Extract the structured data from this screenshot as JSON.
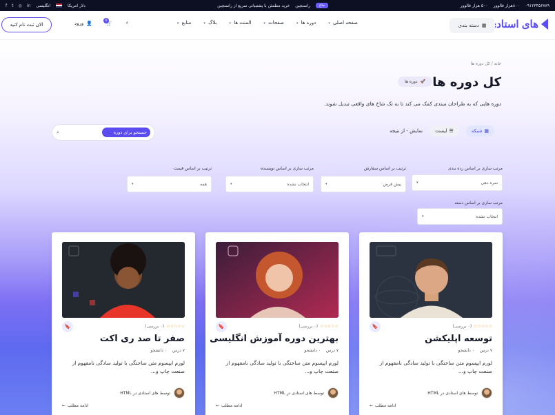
{
  "topbar": {
    "followers_left": "۵۰۰ هزار فالوور",
    "followers_right": "۸۰۰هزار فالوور",
    "phone": "۰۹۱۲۳۴۵۶۷۸۹",
    "tag": "جاع",
    "promo_text": "راستچین",
    "promo_sub": "خرید مطمئن با پشتیبانی سریع از راستچین",
    "language": "انگلیسی",
    "currency": "دلار امریکا"
  },
  "header": {
    "logo": "های استادی",
    "category_button": "دسته بندی",
    "nav": [
      "صفحه اصلی",
      "دوره ها",
      "صفحات",
      "المنت ها",
      "بلاگ",
      "منابع"
    ],
    "login": "ورود",
    "cart_count": "0",
    "signup": "الان ثبت نام کنید"
  },
  "hero": {
    "breadcrumb": "خانه / کل دوره ها",
    "title": "کل دوره ها",
    "badge": "دوره ها",
    "description": "دوره هایی که به طراحان مبتدی کمک می کند تا به تک شاخ های واقعی تبدیل شوند."
  },
  "view": {
    "grid_label": "شبکه",
    "list_label": "لیست",
    "results": "نمایش - از نتیجه"
  },
  "search": {
    "placeholder": "جستجو برای دوره"
  },
  "filters": [
    {
      "label": "مرتب سازی بر اساس رده بندی",
      "value": "نمره دهی"
    },
    {
      "label": "ترتیب بر اساس سفارش",
      "value": "پیش فرض"
    },
    {
      "label": "مرتب سازی بر اساس نویسنده",
      "value": "انتخاب نشده"
    },
    {
      "label": "ترتیب بر اساس قیمت",
      "value": "همه"
    },
    {
      "label": "مرتب سازی بر اساس دسته",
      "value": "انتخاب نشده"
    }
  ],
  "cards": [
    {
      "title": "توسعه اپلیکشن",
      "rating_count": "(۰ بررسی)",
      "lessons": "۷ درس",
      "students": "۰ دانشجو",
      "description": "لورم ایپسوم متن ساختگی با تولید سادگی نامفهوم از صنعت چاپ و...",
      "author": "توسط های استادی در HTML",
      "more": "ادامه مطلب",
      "bg": "#2b3340"
    },
    {
      "title": "بهترین دوره آموزش انگلیسی",
      "rating_count": "(۰ بررسی)",
      "lessons": "۷ درس",
      "students": "۰ دانشجو",
      "description": "لورم ایپسوم متن ساختگی با تولید سادگی نامفهوم از صنعت چاپ و...",
      "author": "توسط های استادی در HTML",
      "more": "ادامه مطلب",
      "bg": "#5a1f3b"
    },
    {
      "title": "صفر تا صد ری اکت",
      "rating_count": "(۰ بررسی)",
      "lessons": "۷ درس",
      "students": "۰ دانشجو",
      "description": "لورم ایپسوم متن ساختگی با تولید سادگی نامفهوم از صنعت چاپ و...",
      "author": "توسط های استادی در HTML",
      "more": "ادامه مطلب",
      "bg": "#24292f"
    }
  ],
  "stars": "☆☆☆☆☆"
}
